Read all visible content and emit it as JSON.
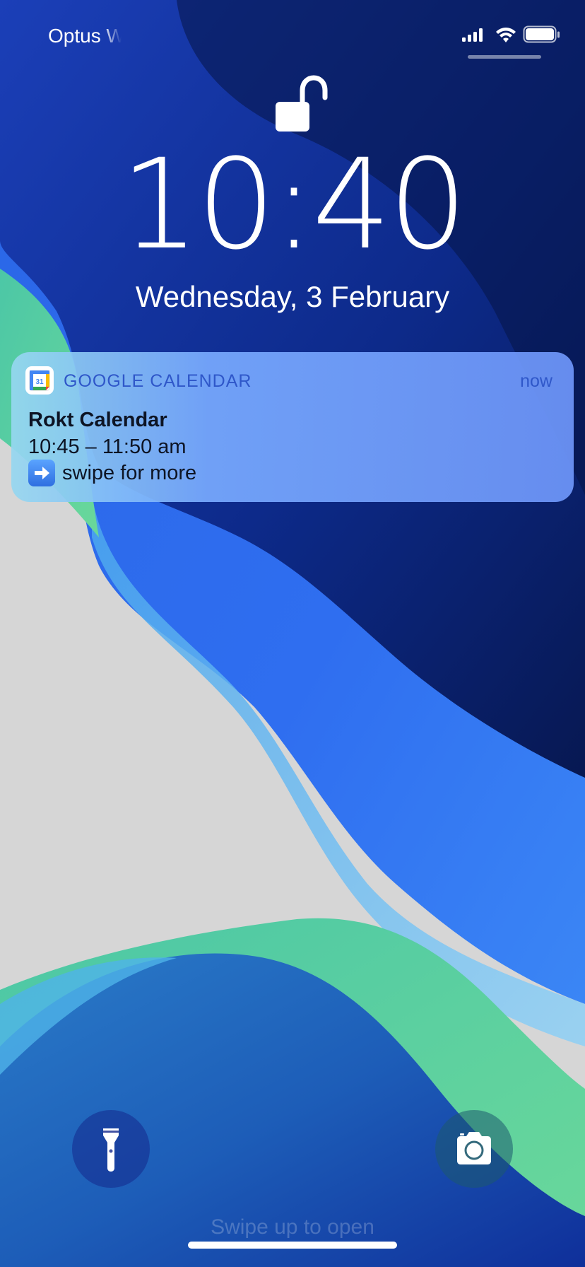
{
  "status_bar": {
    "carrier": "Optus W",
    "signal_icon": "cellular-signal-icon",
    "wifi_icon": "wifi-icon",
    "battery_icon": "battery-icon"
  },
  "lock": {
    "icon": "unlocked-padlock-icon",
    "state": "unlocked"
  },
  "clock": {
    "time": "10:40",
    "date": "Wednesday, 3 February"
  },
  "notification": {
    "app_icon": "google-calendar-icon",
    "app_icon_day": "31",
    "app_name": "GOOGLE CALENDAR",
    "time": "now",
    "title": "Rokt Calendar",
    "body": "10:45 – 11:50 am",
    "more_text": "swipe for more",
    "more_icon": "right-arrow-emoji-icon"
  },
  "quick_actions": {
    "flashlight_icon": "flashlight-icon",
    "camera_icon": "camera-icon"
  },
  "footer": {
    "swipe_hint": "Swipe up to open"
  },
  "colors": {
    "accent_text": "#2f57c9",
    "wallpaper_deep_blue": "#0a1f6e",
    "wallpaper_bright_blue": "#3a7ff0",
    "wallpaper_green": "#5dd59e",
    "wallpaper_gray": "#d6d6d6"
  }
}
